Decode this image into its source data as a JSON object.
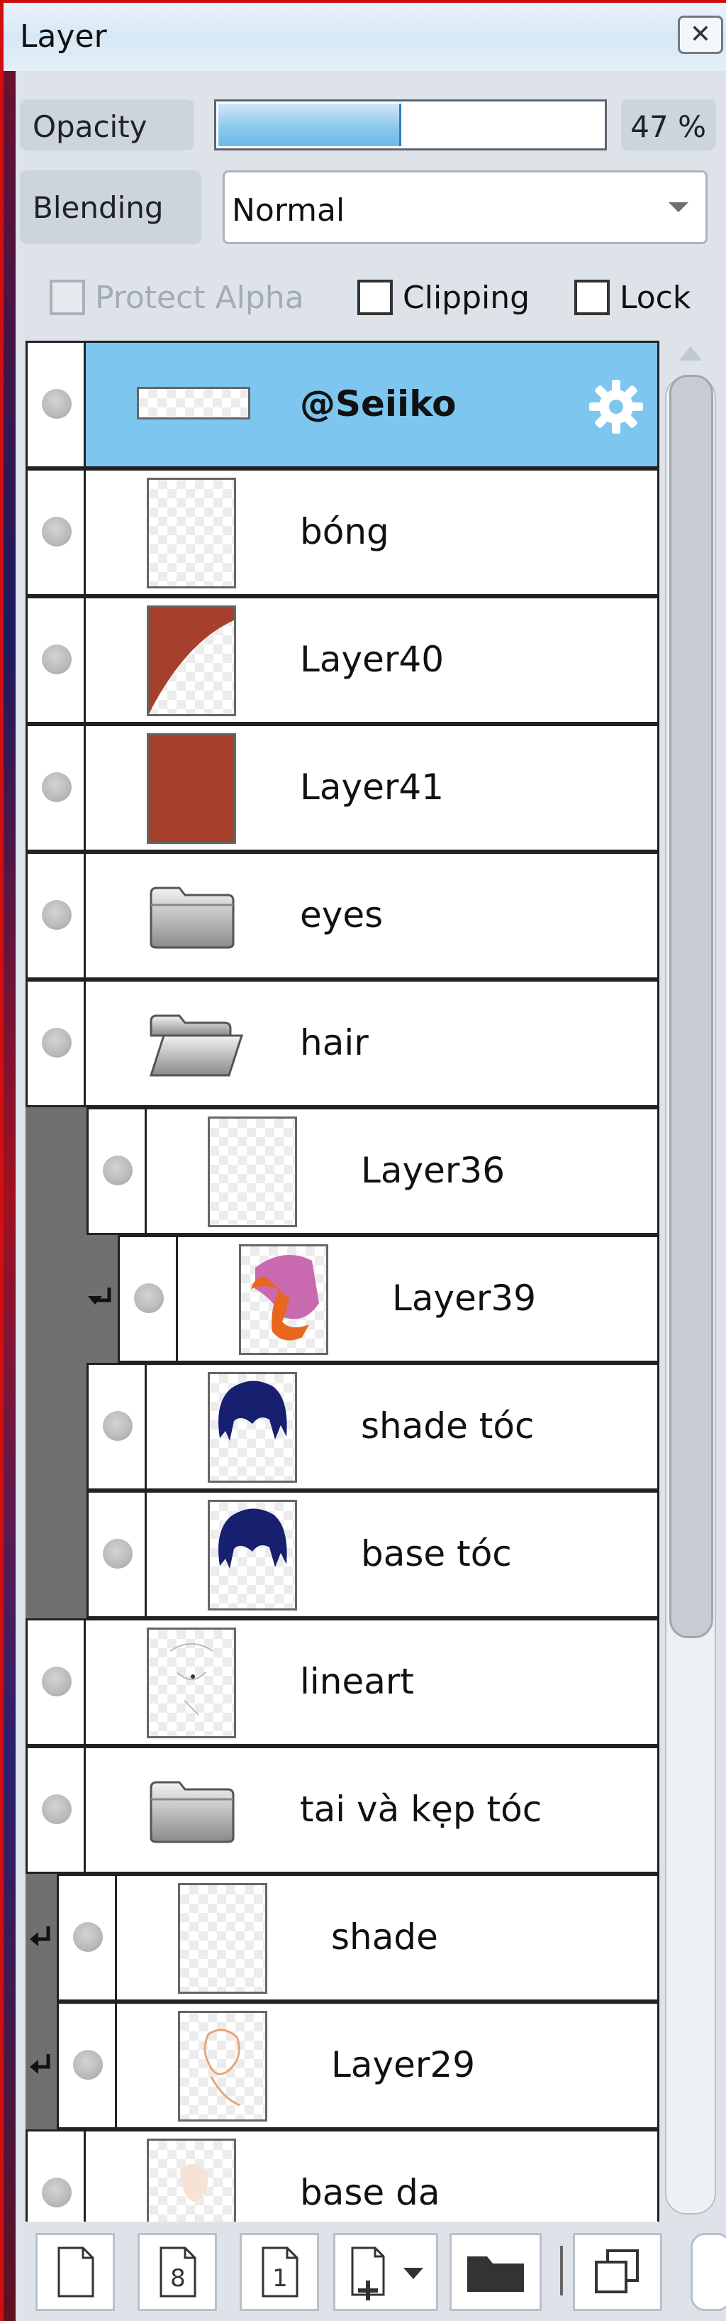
{
  "window": {
    "title": "Layer",
    "close_icon": "close-icon"
  },
  "controls": {
    "opacity_label": "Opacity",
    "opacity_value": 47,
    "opacity_text": "47 %",
    "blending_label": "Blending",
    "blending_value": "Normal",
    "protect_alpha_label": "Protect Alpha",
    "protect_alpha_checked": false,
    "protect_alpha_enabled": false,
    "clipping_label": "Clipping",
    "clipping_checked": false,
    "lock_label": "Lock",
    "lock_checked": false
  },
  "layers": [
    {
      "name": "@Seiiko",
      "kind": "text",
      "selected": true,
      "icon": "gear-icon"
    },
    {
      "name": "bóng",
      "kind": "layer"
    },
    {
      "name": "Layer40",
      "kind": "layer"
    },
    {
      "name": "Layer41",
      "kind": "layer"
    },
    {
      "name": "eyes",
      "kind": "folder"
    },
    {
      "name": "hair",
      "kind": "folder",
      "open": true
    },
    {
      "name": "Layer36",
      "kind": "layer"
    },
    {
      "name": "Layer39",
      "kind": "layer",
      "clipped": true
    },
    {
      "name": "shade tóc",
      "kind": "layer"
    },
    {
      "name": "base tóc",
      "kind": "layer"
    },
    {
      "name": "lineart",
      "kind": "layer"
    },
    {
      "name": "tai và kẹp tóc",
      "kind": "folder"
    },
    {
      "name": "shade",
      "kind": "layer",
      "clipped": true
    },
    {
      "name": "Layer29",
      "kind": "layer",
      "clipped": true
    },
    {
      "name": "base da",
      "kind": "layer"
    }
  ],
  "toolbar": {
    "buttons": [
      "new-layer-icon",
      "new-8bit-layer-icon",
      "new-1bit-layer-icon",
      "add-layer-menu-icon",
      "new-folder-icon",
      "duplicate-layer-icon"
    ],
    "new_8bit_glyph": "8",
    "new_1bit_glyph": "1"
  }
}
